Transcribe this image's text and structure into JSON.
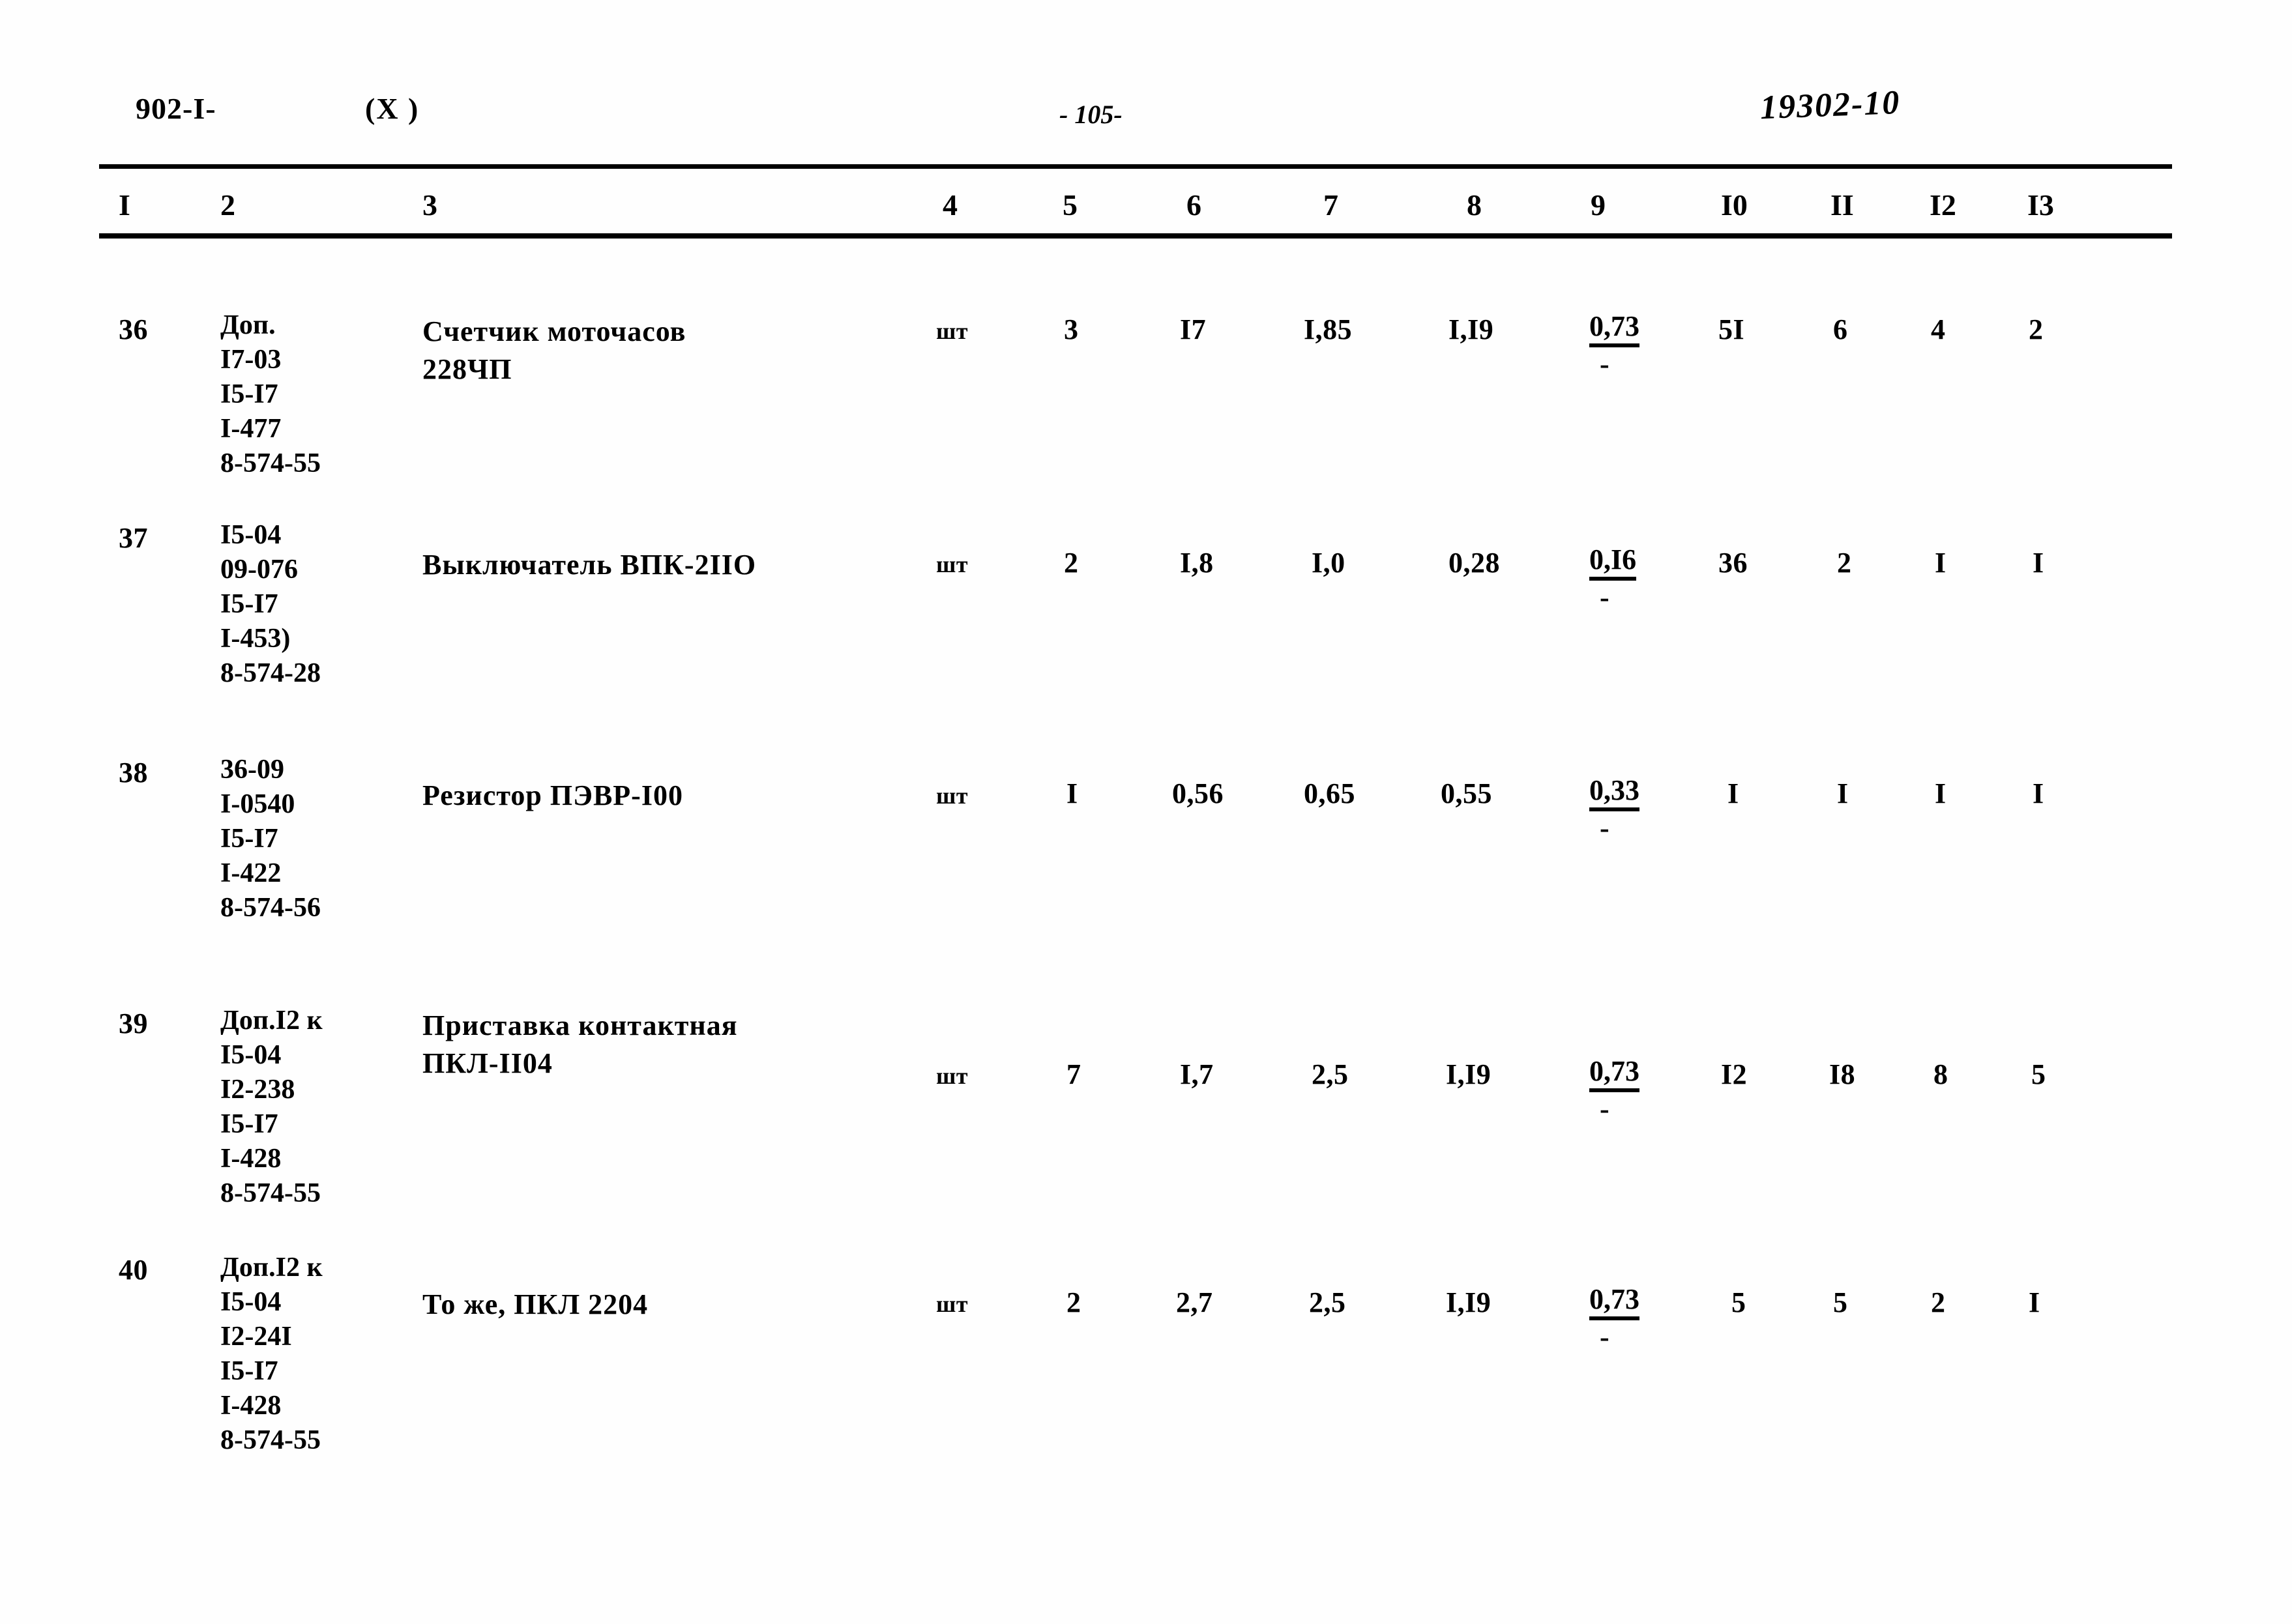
{
  "header": {
    "doc_code": "902-I-",
    "paren": "(Х )",
    "page_number": "- 105-",
    "sheet_mark": "19302-10"
  },
  "table": {
    "column_headers": [
      "I",
      "2",
      "3",
      "4",
      "5",
      "6",
      "7",
      "8",
      "9",
      "I0",
      "II",
      "I2",
      "I3"
    ],
    "rows": [
      {
        "no": "36",
        "codes": "Доп.\nI7-03\nI5-I7\nI-477\n8-574-55",
        "description": "Счетчик моточасов\n228ЧП",
        "unit": "шт",
        "c5": "3",
        "c6": "I7",
        "c7": "I,85",
        "c8": "I,I9",
        "c9_top": "0,73",
        "c9_bot": "-",
        "c10": "5I",
        "c11": "6",
        "c12": "4",
        "c13": "2"
      },
      {
        "no": "37",
        "codes": "I5-04\n09-076\nI5-I7\nI-453)\n8-574-28",
        "description": "Выключатель ВПК-2IIO",
        "unit": "шт",
        "c5": "2",
        "c6": "I,8",
        "c7": "I,0",
        "c8": "0,28",
        "c9_top": "0,I6",
        "c9_bot": "-",
        "c10": "36",
        "c11": "2",
        "c12": "I",
        "c13": "I"
      },
      {
        "no": "38",
        "codes": "36-09\nI-0540\nI5-I7\nI-422\n8-574-56",
        "description": "Резистор ПЭВР-I00",
        "unit": "шт",
        "c5": "I",
        "c6": "0,56",
        "c7": "0,65",
        "c8": "0,55",
        "c9_top": "0,33",
        "c9_bot": "-",
        "c10": "I",
        "c11": "I",
        "c12": "I",
        "c13": "I"
      },
      {
        "no": "39",
        "codes": "Доп.I2 к\nI5-04\nI2-238\nI5-I7\nI-428\n8-574-55",
        "description": "Приставка контактная\nПКЛ-II04",
        "unit": "шт",
        "c5": "7",
        "c6": "I,7",
        "c7": "2,5",
        "c8": "I,I9",
        "c9_top": "0,73",
        "c9_bot": "-",
        "c10": "I2",
        "c11": "I8",
        "c12": "8",
        "c13": "5"
      },
      {
        "no": "40",
        "codes": "Доп.I2 к\nI5-04\nI2-24I\nI5-I7\nI-428\n8-574-55",
        "description": "То же, ПКЛ 2204",
        "unit": "шт",
        "c5": "2",
        "c6": "2,7",
        "c7": "2,5",
        "c8": "I,I9",
        "c9_top": "0,73",
        "c9_bot": "-",
        "c10": "5",
        "c11": "5",
        "c12": "2",
        "c13": "I"
      }
    ]
  }
}
